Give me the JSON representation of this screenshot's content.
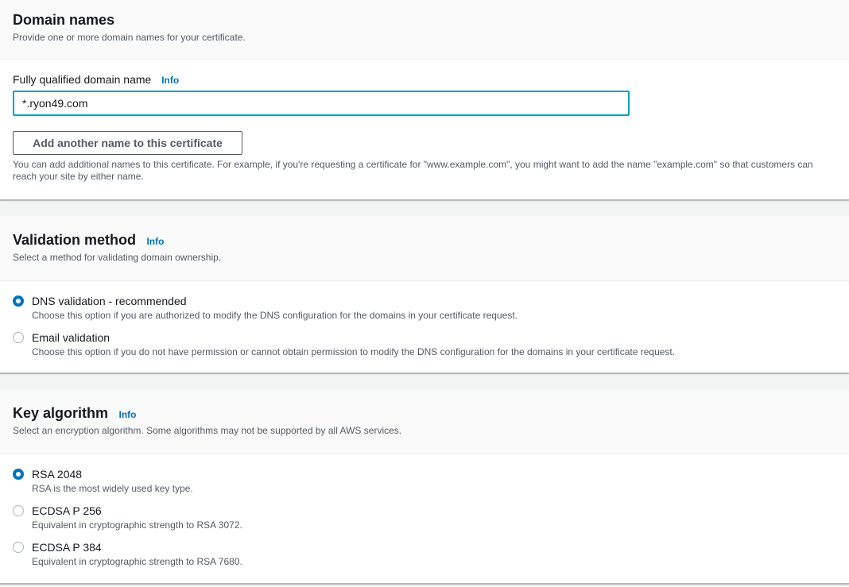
{
  "domain_names": {
    "title": "Domain names",
    "description": "Provide one or more domain names for your certificate.",
    "field_label": "Fully qualified domain name",
    "info_label": "Info",
    "field_value": "*.ryon49.com",
    "add_button_label": "Add another name to this certificate",
    "hint_line1": "You can add additional names to this certificate. For example, if you're requesting a certificate for \"www.example.com\", you might want to add the name \"example.com\" so that customers can",
    "hint_line2": "reach your site by either name."
  },
  "validation_method": {
    "title": "Validation method",
    "info_label": "Info",
    "description": "Select a method for validating domain ownership.",
    "options": [
      {
        "label": "DNS validation - recommended",
        "description": "Choose this option if you are authorized to modify the DNS configuration for the domains in your certificate request.",
        "selected": true
      },
      {
        "label": "Email validation",
        "description": "Choose this option if you do not have permission or cannot obtain permission to modify the DNS configuration for the domains in your certificate request.",
        "selected": false
      }
    ]
  },
  "key_algorithm": {
    "title": "Key algorithm",
    "info_label": "Info",
    "description": "Select an encryption algorithm. Some algorithms may not be supported by all AWS services.",
    "options": [
      {
        "label": "RSA 2048",
        "description": "RSA is the most widely used key type.",
        "selected": true
      },
      {
        "label": "ECDSA P 256",
        "description": "Equivalent in cryptographic strength to RSA 3072.",
        "selected": false
      },
      {
        "label": "ECDSA P 384",
        "description": "Equivalent in cryptographic strength to RSA 7680.",
        "selected": false
      }
    ]
  },
  "colors": {
    "accent": "#0073bb",
    "input_focus": "#00a1c9",
    "text_primary": "#16191f",
    "text_secondary": "#545b64",
    "page_bg": "#f2f3f3"
  }
}
